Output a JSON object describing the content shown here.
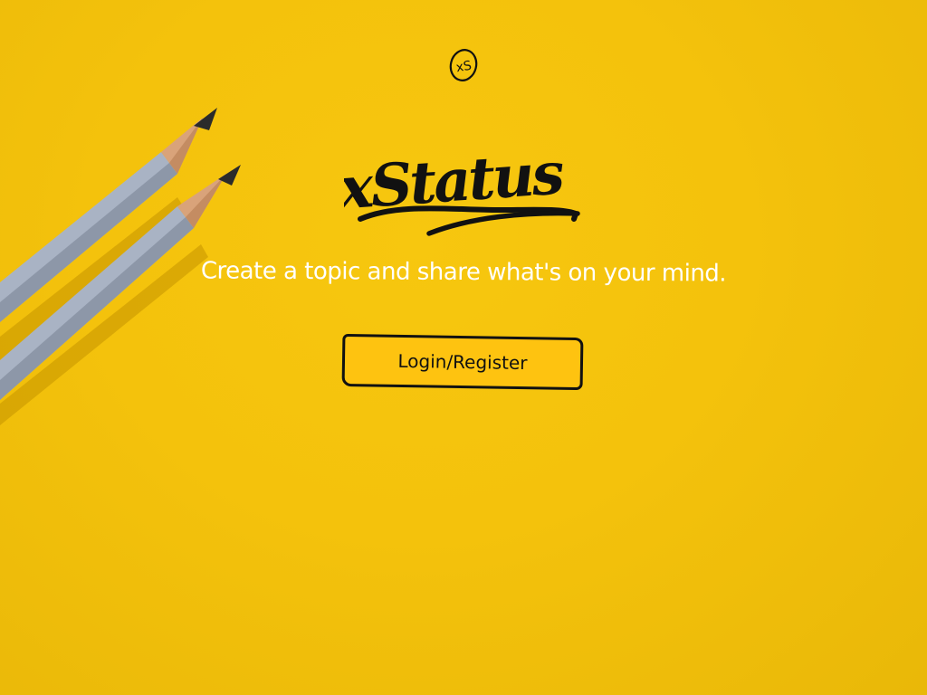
{
  "brand": {
    "badge_text": "xS",
    "wordmark": "xStatus"
  },
  "hero": {
    "tagline": "Create a topic and share what's on your mind."
  },
  "actions": {
    "login_label": "Login/Register"
  },
  "icons": {
    "decoration": "pencils-icon",
    "logo": "xs-logo-icon"
  },
  "colors": {
    "background": "#f4c20c",
    "button_fill": "#fec310",
    "ink": "#111111",
    "tagline": "#ffffff"
  }
}
